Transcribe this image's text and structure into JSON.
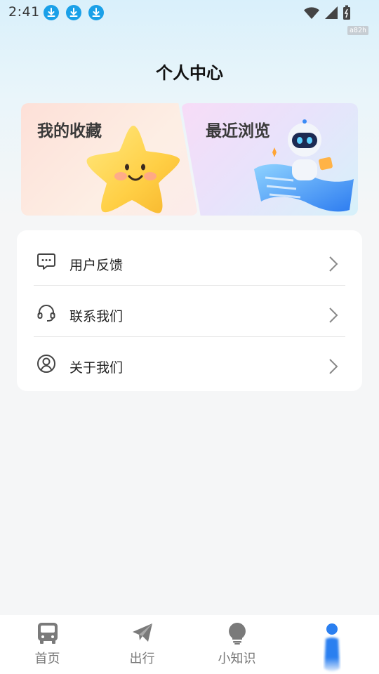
{
  "status_bar": {
    "time": "2:41",
    "download_icons": [
      "download-icon",
      "download-icon",
      "download-icon"
    ],
    "tag": "a82h"
  },
  "page": {
    "title": "个人中心"
  },
  "cards": {
    "favorites": {
      "label": "我的收藏",
      "icon": "star-illustration"
    },
    "recent": {
      "label": "最近浏览",
      "icon": "robot-illustration"
    }
  },
  "menu": {
    "items": [
      {
        "label": "用户反馈",
        "icon": "message-icon"
      },
      {
        "label": "联系我们",
        "icon": "headset-icon"
      },
      {
        "label": "关于我们",
        "icon": "user-circle-icon"
      }
    ]
  },
  "bottom_nav": {
    "items": [
      {
        "label": "首页",
        "icon": "bus-icon"
      },
      {
        "label": "出行",
        "icon": "paper-plane-icon"
      },
      {
        "label": "小知识",
        "icon": "lightbulb-icon"
      },
      {
        "label": "",
        "icon": "profile-indicator-icon"
      }
    ]
  },
  "colors": {
    "accent": "#1aa0e8",
    "active_nav": "#2a7ff0",
    "inactive_nav": "#777777"
  }
}
